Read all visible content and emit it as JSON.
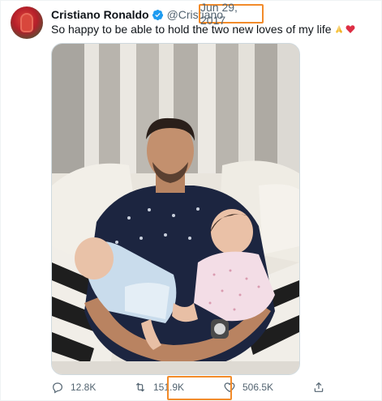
{
  "tweet": {
    "author_name": "Cristiano Ronaldo",
    "handle": "@Cristiano",
    "date": "Jun 29, 2017",
    "text": "So happy to be able to hold the two new loves of my life",
    "emojis": [
      "folded-hands",
      "red-heart"
    ],
    "verified": true
  },
  "actions": {
    "replies": "12.8K",
    "retweets": "151.9K",
    "likes": "506.5K"
  },
  "colors": {
    "highlight": "#f28b2a",
    "verified": "#1d9bf0",
    "muted": "#536471"
  }
}
